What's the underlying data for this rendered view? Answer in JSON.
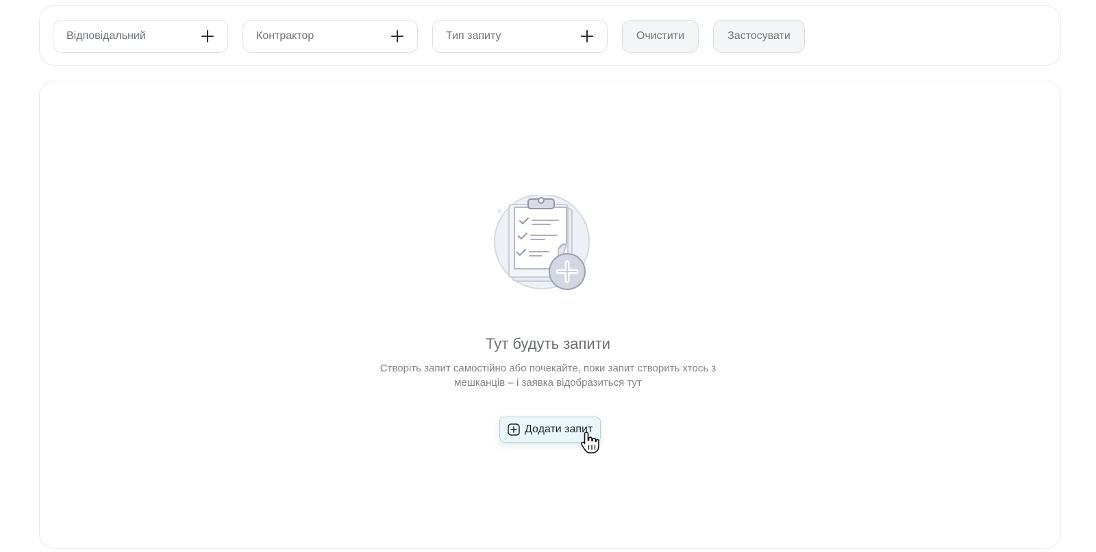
{
  "filters": {
    "responsible_label": "Відповідальний",
    "contractor_label": "Контрактор",
    "request_type_label": "Тип запиту",
    "clear_label": "Очистити",
    "apply_label": "Застосувати"
  },
  "empty_state": {
    "title": "Тут будуть запити",
    "description": "Створіть запит самостійно або почекайте, поки запит створить хтось з мешканців – і заявка відобразиться тут",
    "add_button_label": "Додати запит",
    "illustration_icon": "clipboard-checklist-icon",
    "add_icon": "square-plus-icon"
  },
  "colors": {
    "accent_button_bg": "#eaf7fa",
    "accent_button_border": "#b9cfd4"
  }
}
